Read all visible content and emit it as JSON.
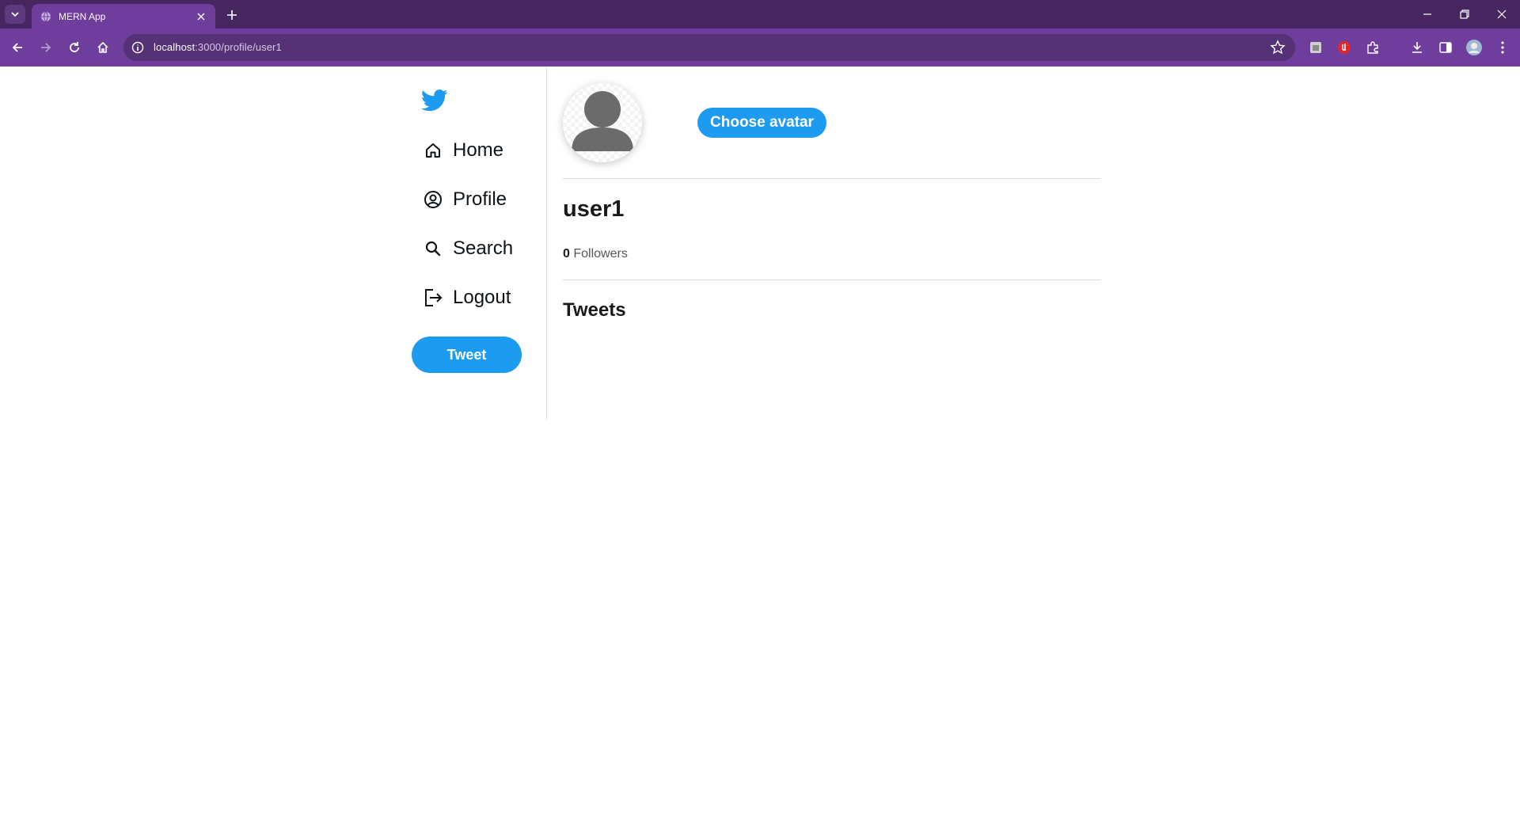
{
  "browser": {
    "tab_title": "MERN App",
    "url_host": "localhost",
    "url_path": ":3000/profile/user1"
  },
  "sidebar": {
    "items": [
      {
        "label": "Home",
        "icon": "home-icon"
      },
      {
        "label": "Profile",
        "icon": "user-circle-icon"
      },
      {
        "label": "Search",
        "icon": "search-icon"
      },
      {
        "label": "Logout",
        "icon": "logout-icon"
      }
    ],
    "tweet_label": "Tweet"
  },
  "profile": {
    "choose_avatar_label": "Choose avatar",
    "username": "user1",
    "followers_count": "0",
    "followers_label": "Followers",
    "tweets_heading": "Tweets"
  },
  "colors": {
    "accent": "#1d9bf0",
    "tabstrip": "#45265f",
    "toolbar": "#6f3d9c"
  }
}
